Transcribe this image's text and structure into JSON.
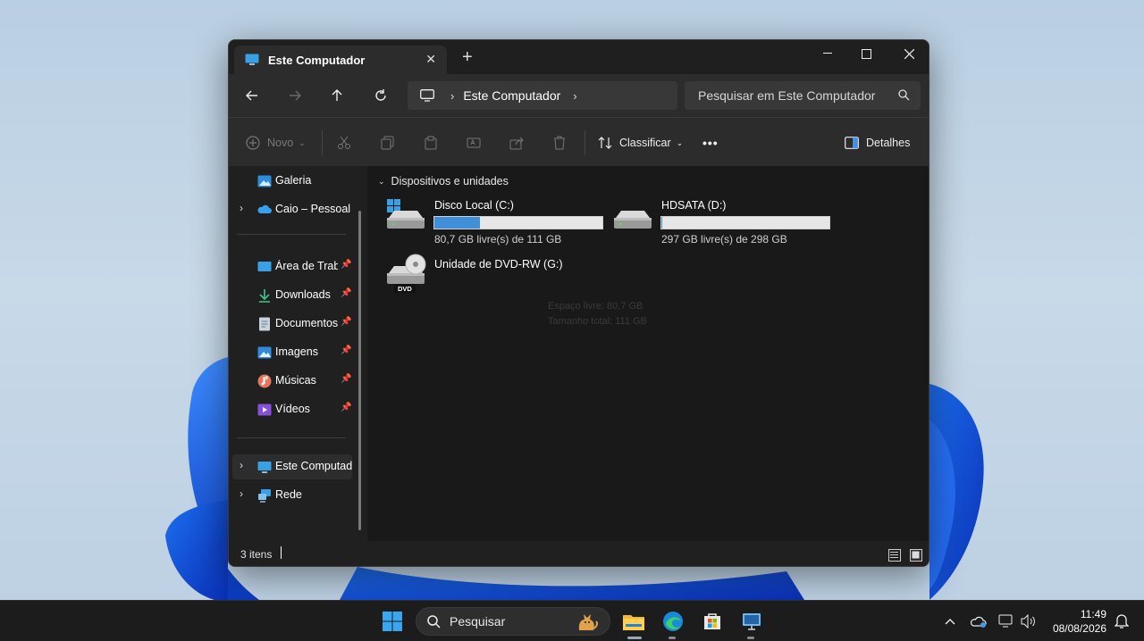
{
  "window": {
    "tab_title": "Este Computador",
    "new_tab": "+",
    "address": {
      "crumb": "Este Computador"
    },
    "search_placeholder": "Pesquisar em Este Computador"
  },
  "toolbar": {
    "new_label": "Novo",
    "sort_label": "Classificar",
    "details_label": "Detalhes",
    "more": "•••"
  },
  "sidebar": {
    "items": [
      {
        "label": "Galeria",
        "icon": "gallery-icon"
      },
      {
        "label": "Caio – Pessoal",
        "icon": "onedrive-icon"
      },
      {
        "label": "Área de Trabalho",
        "icon": "desktop-icon"
      },
      {
        "label": "Downloads",
        "icon": "download-icon"
      },
      {
        "label": "Documentos",
        "icon": "documents-icon"
      },
      {
        "label": "Imagens",
        "icon": "pictures-icon"
      },
      {
        "label": "Músicas",
        "icon": "music-icon"
      },
      {
        "label": "Vídeos",
        "icon": "videos-icon"
      },
      {
        "label": "Este Computador",
        "icon": "this-pc-icon"
      },
      {
        "label": "Rede",
        "icon": "network-icon"
      }
    ]
  },
  "content": {
    "group_label": "Dispositivos e unidades",
    "drives": [
      {
        "name": "Disco Local (C:)",
        "free_text": "80,7 GB livre(s) de 111 GB",
        "used_fraction": 0.27
      },
      {
        "name": "HDSATA (D:)",
        "free_text": "297 GB livre(s) de 298 GB",
        "used_fraction": 0.003
      },
      {
        "name": "Unidade de DVD-RW (G:)",
        "badge": "DVD"
      }
    ],
    "ghost_lines": [
      "Espaço livre: 80,7 GB",
      "Tamanho total: 111 GB"
    ]
  },
  "status": {
    "count": "3 itens"
  },
  "taskbar": {
    "search_placeholder": "Pesquisar",
    "time": "11:49",
    "date": "08/08/2026"
  },
  "colors": {
    "accent": "#3f8fd9",
    "window_bg": "#191919",
    "taskbar_bg": "#1c1c1c"
  }
}
